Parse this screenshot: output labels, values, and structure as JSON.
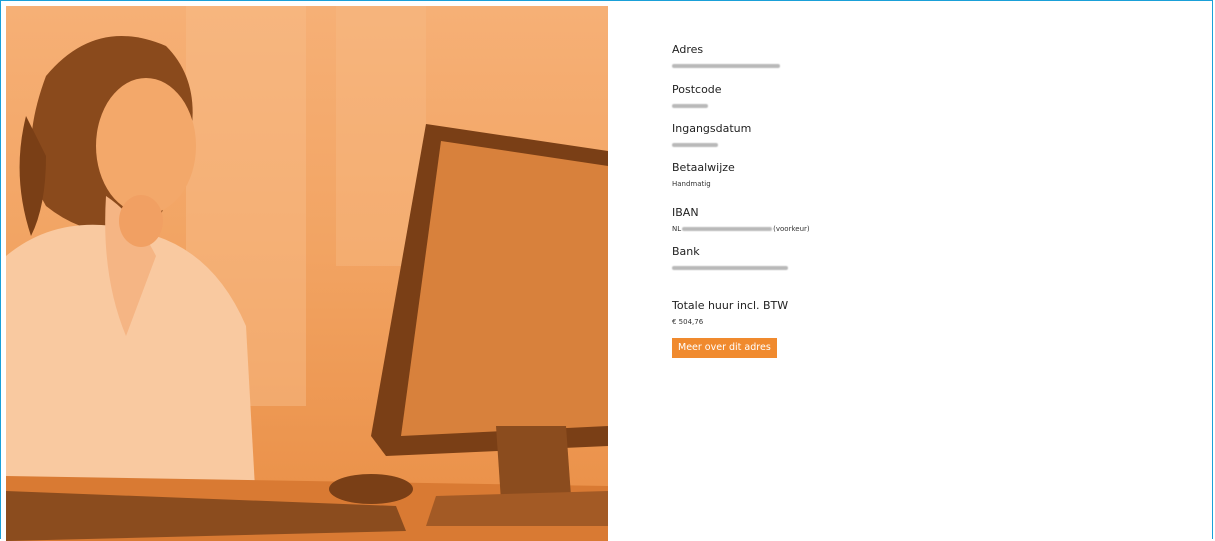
{
  "fields": {
    "adres_label": "Adres",
    "postcode_label": "Postcode",
    "ingangsdatum_label": "Ingangsdatum",
    "betaalwijze_label": "Betaalwijze",
    "betaalwijze_value": "Handmatig",
    "iban_label": "IBAN",
    "iban_prefix": "NL",
    "iban_suffix": "(voorkeur)",
    "bank_label": "Bank",
    "totale_huur_label": "Totale huur incl. BTW",
    "totale_huur_value": "€ 504,76"
  },
  "actions": {
    "meer_label": "Meer over dit adres"
  },
  "colors": {
    "accent": "#f08a2e",
    "frame": "#1aa0d8",
    "photo_tint": "#f2a463"
  }
}
